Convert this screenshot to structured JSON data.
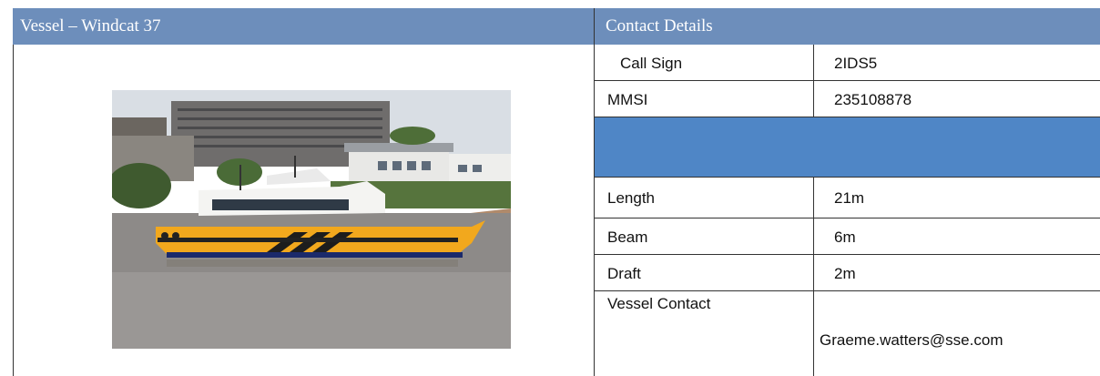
{
  "vessel_panel": {
    "title": "Vessel – Windcat 37"
  },
  "contact_panel": {
    "title": "Contact Details",
    "rows": [
      {
        "label": "Call Sign",
        "value": "2IDS5"
      },
      {
        "label": "MMSI",
        "value": "235108878"
      },
      {
        "label": "Length",
        "value": "21m"
      },
      {
        "label": "Beam",
        "value": "6m"
      },
      {
        "label": "Draft",
        "value": "2m"
      },
      {
        "label": "Vessel Contact",
        "value": "Graeme.watters@sse.com"
      }
    ]
  },
  "colors": {
    "header_bg": "#6d8ebb",
    "separator_row": "#4f86c6",
    "hull": "#f2a81d"
  }
}
